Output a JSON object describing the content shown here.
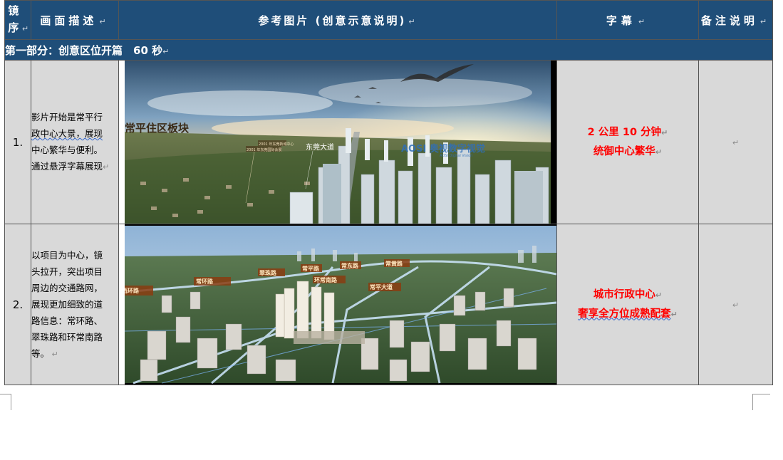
{
  "header": {
    "col1": "镜序",
    "col2": "画面描述",
    "col3": "参考图片 (创意示意说明)",
    "col4": "字幕",
    "col5": "备注说明"
  },
  "section": {
    "title": "第一部分：创意区位开篇　60 秒"
  },
  "rows": [
    {
      "num": "1.",
      "desc_lines": [
        "影片开始是常平行",
        "政中心大景，展现",
        "中心繁华与便利。",
        "通过悬浮字幕展现"
      ],
      "caption_lines": [
        "2 公里 10 分钟",
        "统御中心繁华"
      ],
      "image_labels": {
        "district": "常平住区板块",
        "road": "东莞大道",
        "tag1": "2001 年东莞新城中心",
        "tag2": "2001 年东莞国际会展",
        "watermark": "AOSI 奥视数字视觉",
        "watermark_sub": "AOSI Digital Vision"
      }
    },
    {
      "num": "2.",
      "desc_lines": [
        "以项目为中心，镜",
        "头拉开，突出项目",
        "周边的交通路网，",
        "展现更加细致的道",
        "路信息：常环路、",
        "翠珠路和环常南路",
        "等。"
      ],
      "caption_lines": [
        "城市行政中心",
        "奢享全方位成熟配套"
      ],
      "image_labels": {
        "road1": "常环路",
        "road2": "翠珠路",
        "road3": "环常南路",
        "road4": "常平路",
        "road5": "常东路",
        "road6": "常黄路",
        "road7": "常平大道",
        "road8": "西环路"
      }
    }
  ],
  "colors": {
    "header_bg": "#1f4e79",
    "cell_bg": "#d9d9d9",
    "caption_red": "#ff0000"
  }
}
